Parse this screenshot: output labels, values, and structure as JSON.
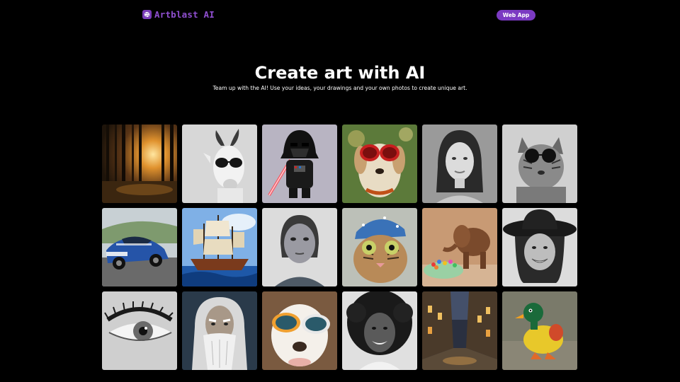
{
  "brand": {
    "name": "Artblast AI",
    "logo_icon": "palette-icon",
    "accent_color": "#7b3ac2"
  },
  "nav": {
    "web_app_label": "Web App"
  },
  "hero": {
    "title": "Create art with AI",
    "subtitle": "Team up with the AI! Use your ideas, your drawings and your own photos to create unique art."
  },
  "gallery": {
    "images": [
      {
        "subject": "sunset-forest-image"
      },
      {
        "subject": "goat-sunglasses-image"
      },
      {
        "subject": "darth-vader-toy-image"
      },
      {
        "subject": "dog-red-sunglasses-image"
      },
      {
        "subject": "woman-portrait-image"
      },
      {
        "subject": "cat-sunglasses-image"
      },
      {
        "subject": "blue-sports-car-image"
      },
      {
        "subject": "sailing-ship-image"
      },
      {
        "subject": "painted-girl-image"
      },
      {
        "subject": "cat-blue-hat-image"
      },
      {
        "subject": "wooden-elephant-candy-image"
      },
      {
        "subject": "woman-hat-portrait-image"
      },
      {
        "subject": "eye-closeup-image"
      },
      {
        "subject": "old-wizard-portrait-image"
      },
      {
        "subject": "dog-goggles-image"
      },
      {
        "subject": "curly-hair-woman-image"
      },
      {
        "subject": "night-street-image"
      },
      {
        "subject": "toy-duck-image"
      }
    ]
  }
}
